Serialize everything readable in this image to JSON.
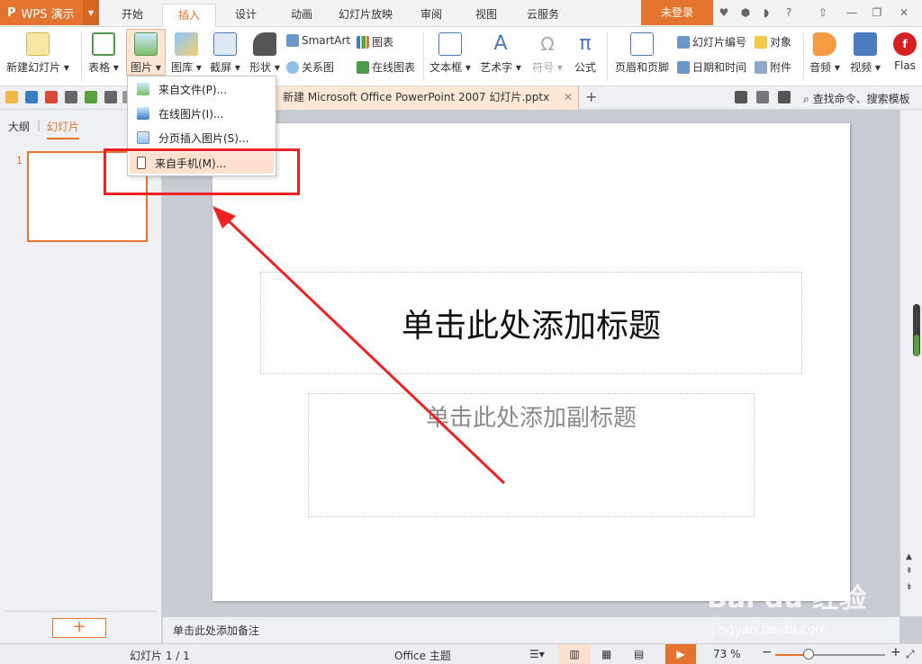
{
  "app": {
    "logo": "P",
    "name": "WPS 演示"
  },
  "menu": {
    "tabs": [
      "开始",
      "插入",
      "设计",
      "动画",
      "幻灯片放映",
      "审阅",
      "视图",
      "云服务"
    ],
    "active": "插入",
    "login": "未登录"
  },
  "ribbon": {
    "new_slide": "新建幻灯片",
    "table": "表格",
    "picture": "图片",
    "gallery": "图库",
    "screenshot": "截屏",
    "shapes": "形状",
    "smartart": "SmartArt",
    "relation": "关系图",
    "chart": "图表",
    "online_chart": "在线图表",
    "textbox": "文本框",
    "wordart": "艺术字",
    "symbol": "符号",
    "formula": "公式",
    "header_footer": "页眉和页脚",
    "slide_number": "幻灯片编号",
    "datetime": "日期和时间",
    "object": "对象",
    "attachment": "附件",
    "audio": "音频",
    "video": "视频",
    "flash": "Flas"
  },
  "doc_tab": {
    "title": "新建 Microsoft Office PowerPoint 2007 幻灯片.pptx"
  },
  "search_cmd": "查找命令、搜索模板",
  "left_panel": {
    "tab_outline": "大纲",
    "tab_slides": "幻灯片",
    "slide_number": "1",
    "add_label": "+"
  },
  "slide": {
    "title_placeholder": "单击此处添加标题",
    "subtitle_placeholder": "单击此处添加副标题"
  },
  "notes_placeholder": "单击此处添加备注",
  "status": {
    "slide_info": "幻灯片 1 / 1",
    "theme": "Office 主题",
    "zoom": "73 %",
    "zoom_level": 0.3
  },
  "dropdown": {
    "items": [
      "来自文件(P)...",
      "在线图片(I)...",
      "分页插入图片(S)...",
      "来自手机(M)..."
    ],
    "highlighted_index": 3
  },
  "watermark": {
    "brand": "Bai du 经验",
    "url": "jingyan.baidu.com"
  },
  "colors": {
    "accent": "#e5742f",
    "annotation": "#ee2222"
  }
}
